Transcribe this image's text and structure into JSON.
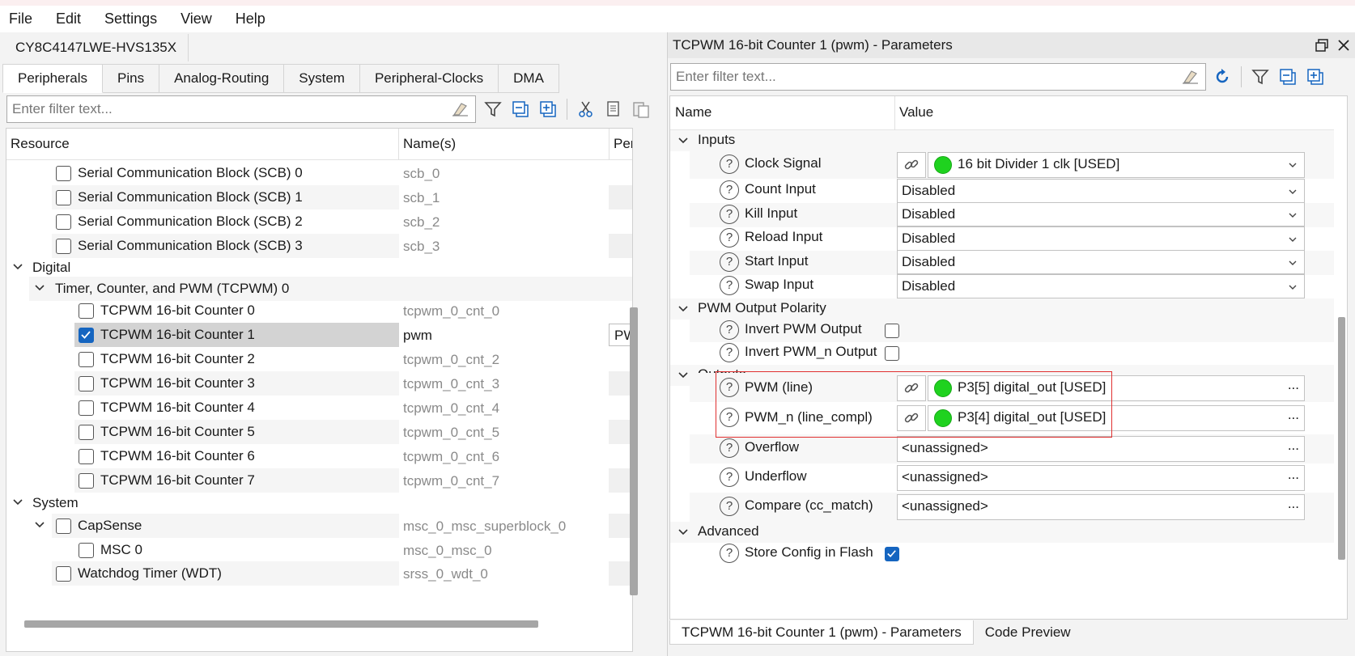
{
  "menu": [
    "File",
    "Edit",
    "Settings",
    "View",
    "Help"
  ],
  "left": {
    "device_tab": "CY8C4147LWE-HVS135X",
    "tabs": [
      "Peripherals",
      "Pins",
      "Analog-Routing",
      "System",
      "Peripheral-Clocks",
      "DMA"
    ],
    "active_tab": "Peripherals",
    "filter_placeholder": "Enter filter text...",
    "columns": [
      "Resource",
      "Name(s)",
      "Per"
    ],
    "rows": [
      {
        "label": "Serial Communication Block (SCB) 0",
        "name": "scb_0"
      },
      {
        "label": "Serial Communication Block (SCB) 1",
        "name": "scb_1"
      },
      {
        "label": "Serial Communication Block (SCB) 2",
        "name": "scb_2"
      },
      {
        "label": "Serial Communication Block (SCB) 3",
        "name": "scb_3"
      },
      {
        "label": "Digital",
        "name": ""
      },
      {
        "label": "Timer, Counter, and PWM (TCPWM) 0",
        "name": ""
      },
      {
        "label": "TCPWM 16-bit Counter 0",
        "name": "tcpwm_0_cnt_0"
      },
      {
        "label": "TCPWM 16-bit Counter 1",
        "name": "pwm",
        "per": "PW"
      },
      {
        "label": "TCPWM 16-bit Counter 2",
        "name": "tcpwm_0_cnt_2"
      },
      {
        "label": "TCPWM 16-bit Counter 3",
        "name": "tcpwm_0_cnt_3"
      },
      {
        "label": "TCPWM 16-bit Counter 4",
        "name": "tcpwm_0_cnt_4"
      },
      {
        "label": "TCPWM 16-bit Counter 5",
        "name": "tcpwm_0_cnt_5"
      },
      {
        "label": "TCPWM 16-bit Counter 6",
        "name": "tcpwm_0_cnt_6"
      },
      {
        "label": "TCPWM 16-bit Counter 7",
        "name": "tcpwm_0_cnt_7"
      },
      {
        "label": "System",
        "name": ""
      },
      {
        "label": "CapSense",
        "name": "msc_0_msc_superblock_0"
      },
      {
        "label": "MSC 0",
        "name": "msc_0_msc_0"
      },
      {
        "label": "Watchdog Timer (WDT)",
        "name": "srss_0_wdt_0"
      }
    ]
  },
  "right": {
    "title": "TCPWM 16-bit Counter 1 (pwm) - Parameters",
    "filter_placeholder": "Enter filter text...",
    "columns": [
      "Name",
      "Value"
    ],
    "sections": {
      "inputs": "Inputs",
      "polarity": "PWM Output Polarity",
      "outputs": "Outputs",
      "advanced": "Advanced"
    },
    "params": {
      "clock_signal": {
        "label": "Clock Signal",
        "value": "16 bit Divider 1 clk [USED]"
      },
      "count_input": {
        "label": "Count Input",
        "value": "Disabled"
      },
      "kill_input": {
        "label": "Kill Input",
        "value": "Disabled"
      },
      "reload_input": {
        "label": "Reload Input",
        "value": "Disabled"
      },
      "start_input": {
        "label": "Start Input",
        "value": "Disabled"
      },
      "swap_input": {
        "label": "Swap Input",
        "value": "Disabled"
      },
      "invert_pwm": {
        "label": "Invert PWM Output",
        "checked": false
      },
      "invert_pwm_n": {
        "label": "Invert PWM_n Output",
        "checked": false
      },
      "pwm_line": {
        "label": "PWM (line)",
        "value": "P3[5] digital_out [USED]"
      },
      "pwm_n_line": {
        "label": "PWM_n (line_compl)",
        "value": "P3[4] digital_out [USED]"
      },
      "overflow": {
        "label": "Overflow",
        "value": "<unassigned>"
      },
      "underflow": {
        "label": "Underflow",
        "value": "<unassigned>"
      },
      "compare": {
        "label": "Compare (cc_match)",
        "value": "<unassigned>"
      },
      "store_config": {
        "label": "Store Config in Flash",
        "checked": true
      }
    },
    "dots_label": "...",
    "help_glyph": "?",
    "bottom_tabs": [
      "TCPWM 16-bit Counter 1 (pwm) - Parameters",
      "Code Preview"
    ]
  },
  "colors": {
    "accent": "#1565c0",
    "used_dot": "#1fd21f",
    "highlight": "#e03030",
    "selected_row": "#d3d3d3"
  }
}
